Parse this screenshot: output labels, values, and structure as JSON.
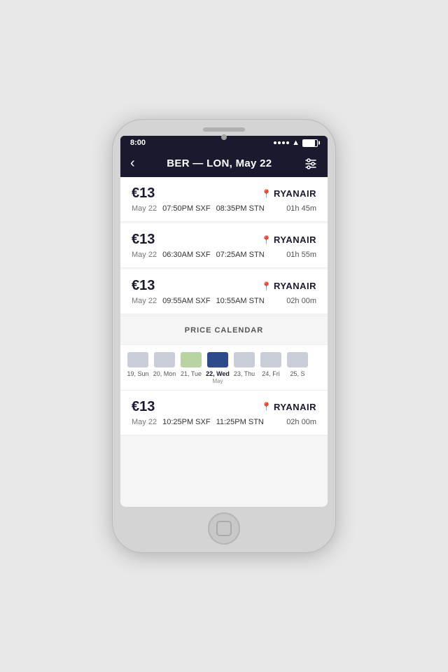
{
  "phone": {
    "status_bar": {
      "time": "8:00",
      "battery_label": "Battery"
    },
    "nav": {
      "back_icon": "‹",
      "title": "BER — LON, May 22",
      "filter_icon": "filter"
    },
    "flights": [
      {
        "price": "€13",
        "airline": "RYANAIR",
        "date": "May 22",
        "depart_time": "07:50PM",
        "depart_airport": "SXF",
        "arrive_time": "08:35PM",
        "arrive_airport": "STN",
        "duration": "01h 45m"
      },
      {
        "price": "€13",
        "airline": "RYANAIR",
        "date": "May 22",
        "depart_time": "06:30AM",
        "depart_airport": "SXF",
        "arrive_time": "07:25AM",
        "arrive_airport": "STN",
        "duration": "01h 55m"
      },
      {
        "price": "€13",
        "airline": "RYANAIR",
        "date": "May 22",
        "depart_time": "09:55AM",
        "depart_airport": "SXF",
        "arrive_time": "10:55AM",
        "arrive_airport": "STN",
        "duration": "02h 00m"
      }
    ],
    "calendar": {
      "header": "PRICE CALENDAR",
      "days": [
        {
          "num": "19",
          "label": "Sun",
          "bar_type": "grey",
          "month": ""
        },
        {
          "num": "20",
          "label": "Mon",
          "bar_type": "grey",
          "month": ""
        },
        {
          "num": "21",
          "label": "Tue",
          "bar_type": "green",
          "month": ""
        },
        {
          "num": "22",
          "label": "Wed",
          "bar_type": "navy",
          "month": "May",
          "selected": true
        },
        {
          "num": "23",
          "label": "Thu",
          "bar_type": "grey",
          "month": ""
        },
        {
          "num": "24",
          "label": "Fri",
          "bar_type": "grey",
          "month": ""
        },
        {
          "num": "25",
          "label": "S",
          "bar_type": "grey",
          "month": ""
        }
      ]
    },
    "flight_bottom": {
      "price": "€13",
      "airline": "RYANAIR",
      "date": "May 22",
      "depart_time": "10:25PM",
      "depart_airport": "SXF",
      "arrive_time": "11:25PM",
      "arrive_airport": "STN",
      "duration": "02h 00m"
    }
  }
}
